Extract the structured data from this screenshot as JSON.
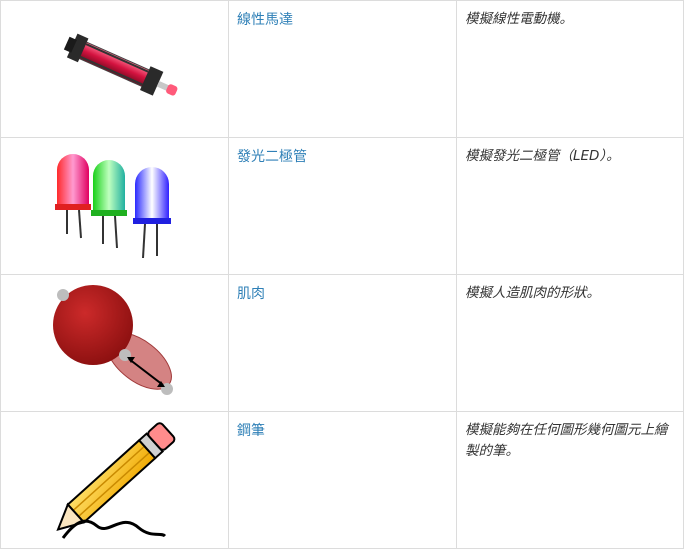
{
  "rows": [
    {
      "icon": "linear-motor-icon",
      "name": "線性馬達",
      "description": "模擬線性電動機。"
    },
    {
      "icon": "led-icon",
      "name": "發光二極管",
      "description": "模擬發光二極管（LED）。"
    },
    {
      "icon": "muscle-icon",
      "name": "肌肉",
      "description": "模擬人造肌肉的形狀。"
    },
    {
      "icon": "pencil-icon",
      "name": "鋼筆",
      "description": "模擬能夠在任何圖形幾何圖元上繪製的筆。"
    }
  ]
}
